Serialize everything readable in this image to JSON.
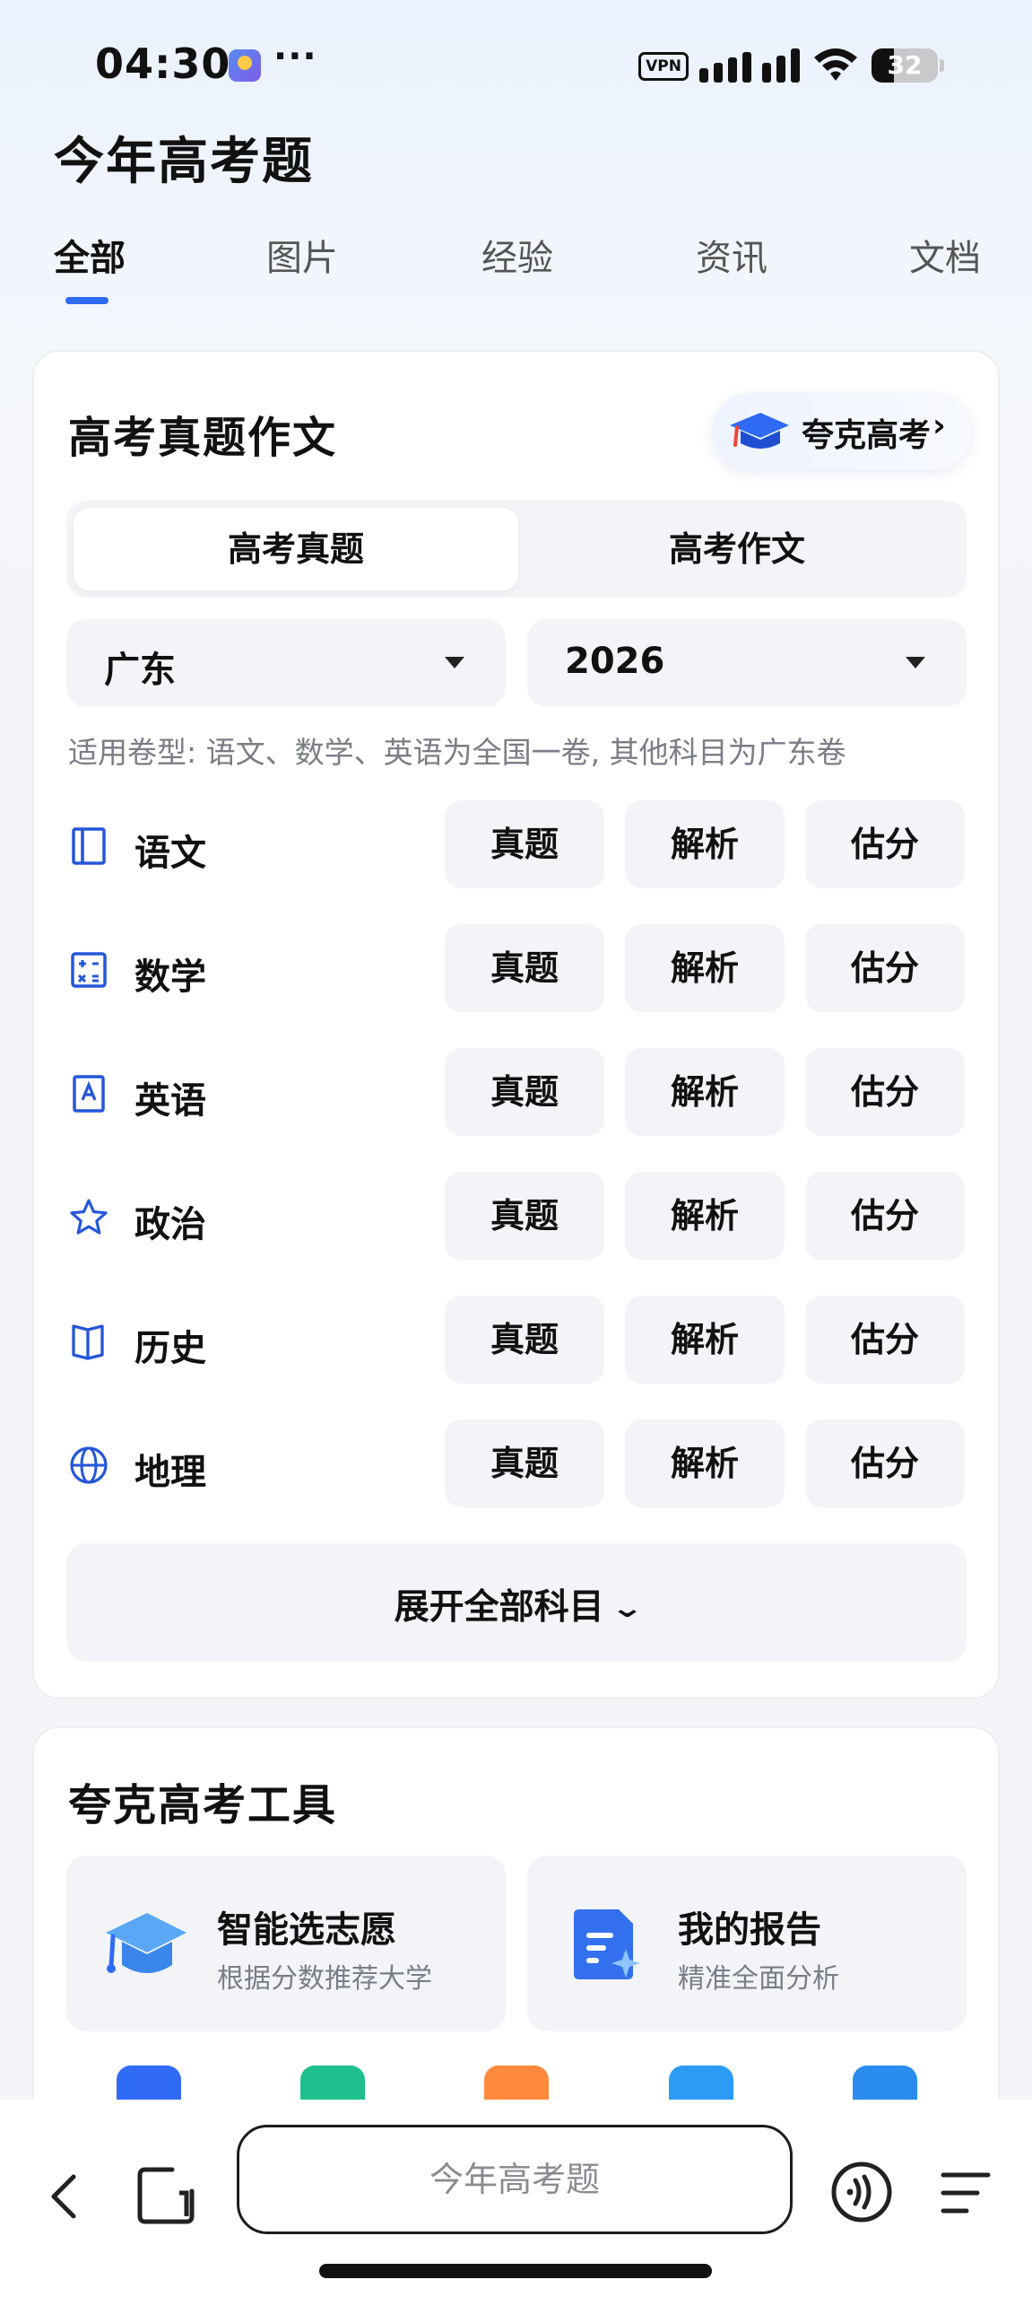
{
  "status_bar": {
    "time": "04:30",
    "more": "···",
    "vpn": "VPN",
    "battery": "32"
  },
  "header": {
    "title": "今年高考题",
    "tabs": [
      {
        "label": "全部",
        "active": true
      },
      {
        "label": "图片",
        "active": false
      },
      {
        "label": "经验",
        "active": false
      },
      {
        "label": "资讯",
        "active": false
      },
      {
        "label": "文档",
        "active": false
      }
    ]
  },
  "exam_card": {
    "title": "高考真题作文",
    "brand_link": "夸克高考",
    "segments": [
      {
        "label": "高考真题",
        "active": true
      },
      {
        "label": "高考作文",
        "active": false
      }
    ],
    "province": "广东",
    "year": "2026",
    "note": "适用卷型: 语文、数学、英语为全国一卷, 其他科目为广东卷",
    "actions": [
      "真题",
      "解析",
      "估分"
    ],
    "subjects": [
      {
        "name": "语文",
        "icon": "book-icon"
      },
      {
        "name": "数学",
        "icon": "calculator-icon"
      },
      {
        "name": "英语",
        "icon": "letter-a-icon"
      },
      {
        "name": "政治",
        "icon": "star-icon"
      },
      {
        "name": "历史",
        "icon": "open-book-icon"
      },
      {
        "name": "地理",
        "icon": "globe-icon"
      }
    ],
    "expand_label": "展开全部科目"
  },
  "tools_card": {
    "title": "夸克高考工具",
    "tools": [
      {
        "name": "智能选志愿",
        "sub": "根据分数推荐大学",
        "icon": "graduation-cap-icon"
      },
      {
        "name": "我的报告",
        "sub": "精准全面分析",
        "icon": "report-icon"
      }
    ],
    "mini_icons": [
      "school-icon",
      "bookmark-icon",
      "ticket-icon",
      "edit-icon",
      "send-icon"
    ]
  },
  "bottom_bar": {
    "search_placeholder": "今年高考题"
  },
  "colors": {
    "accent": "#2f6bf6",
    "icon_blue": "#2456d8",
    "chip_bg": "#f3f4f8"
  }
}
